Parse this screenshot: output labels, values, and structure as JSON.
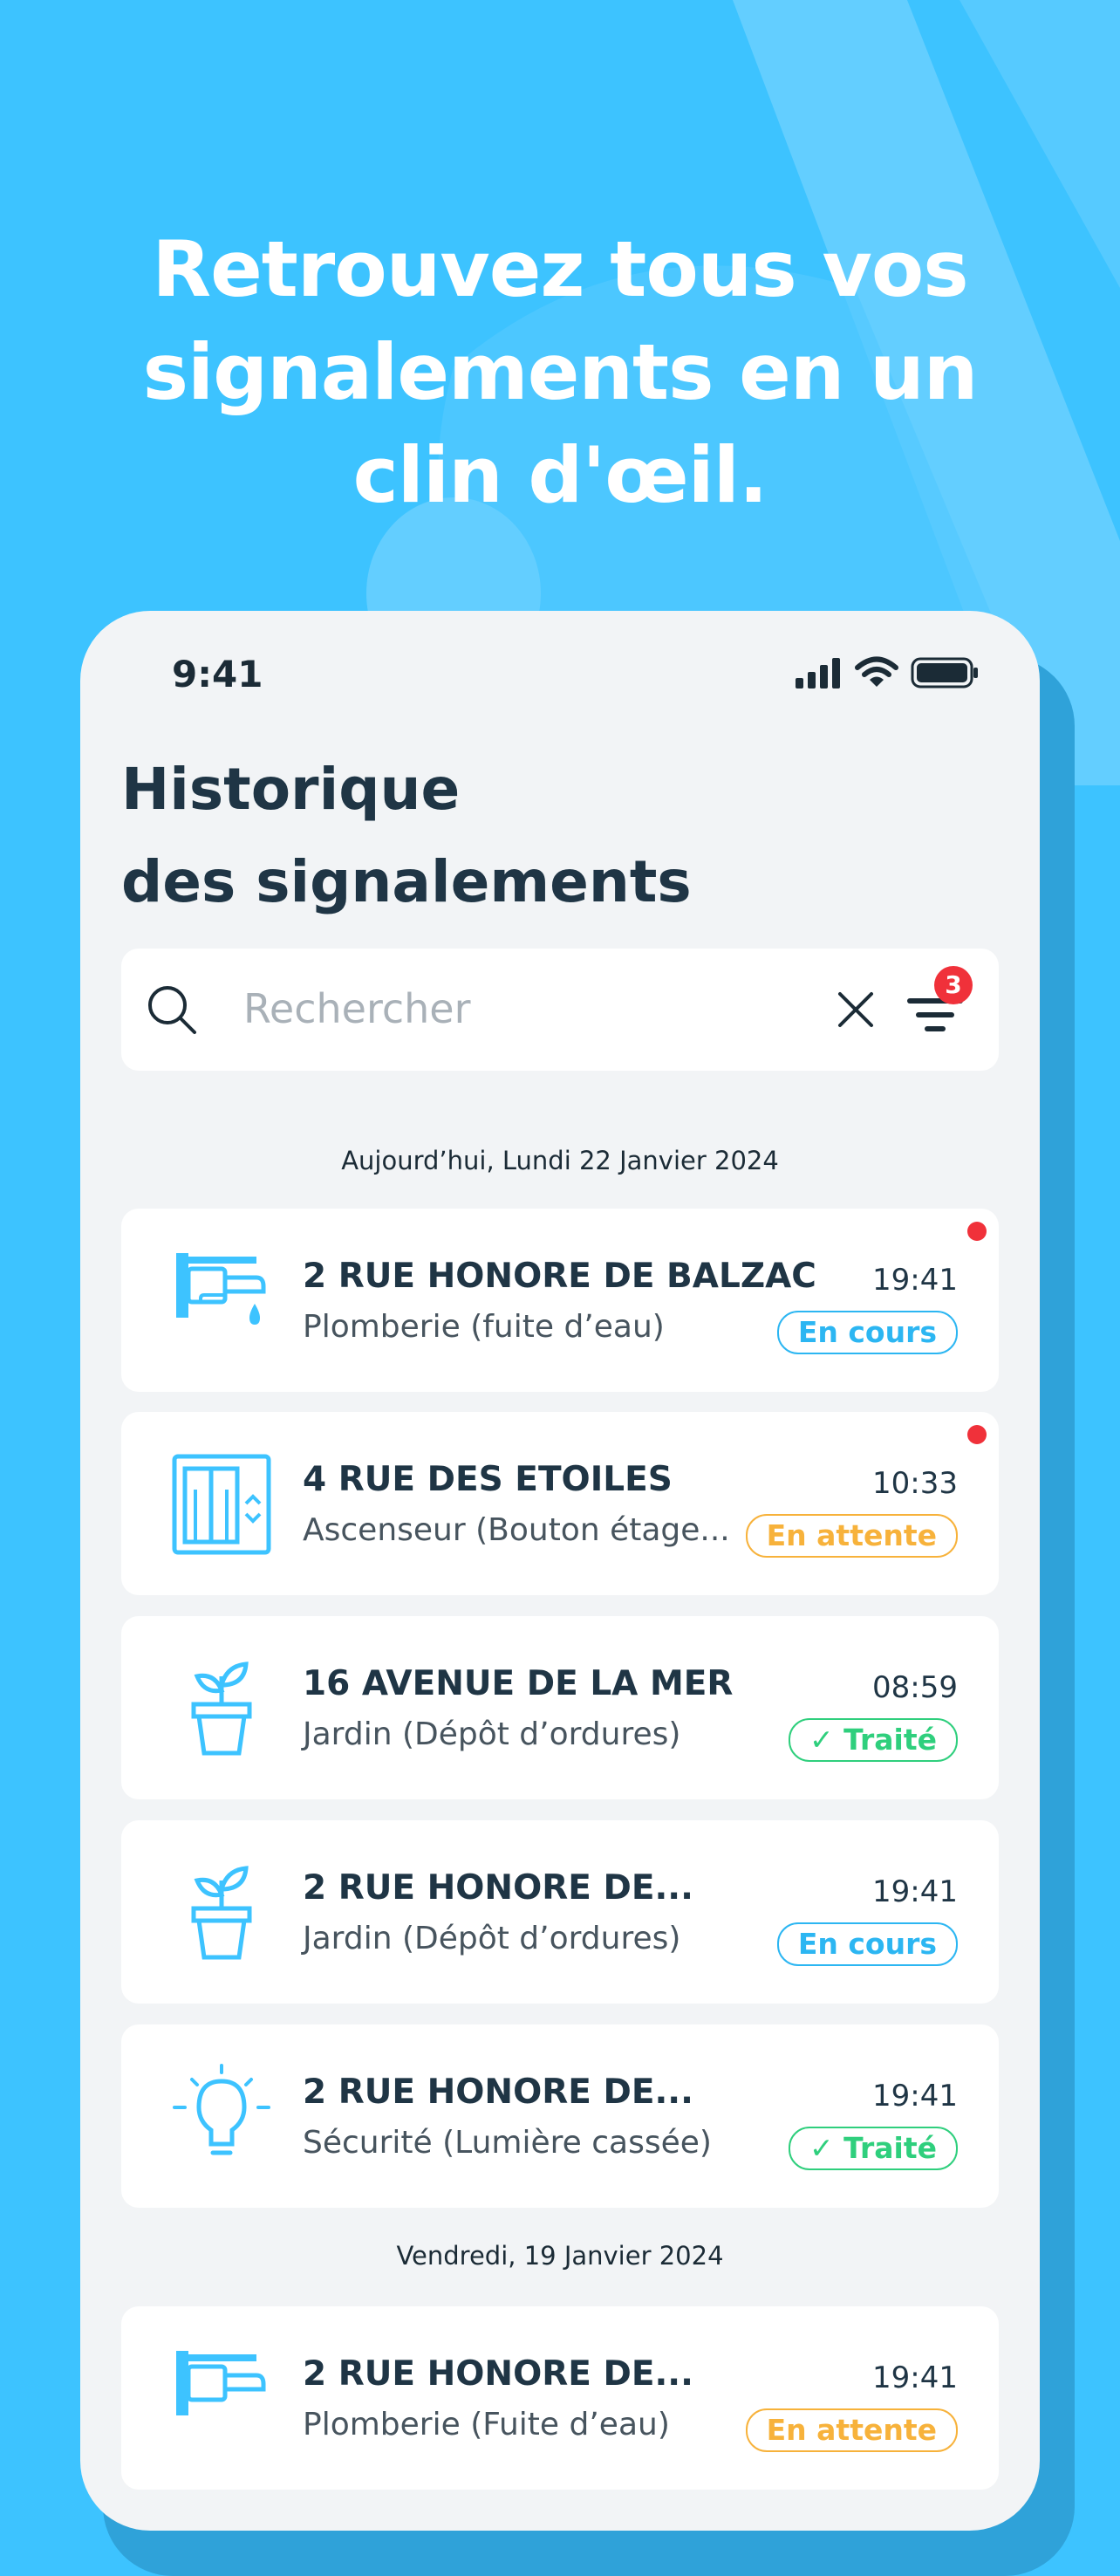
{
  "headline": {
    "line1": "Retrouvez tous vos",
    "line2": "signalements en un",
    "line3": "clin d'œil."
  },
  "status_bar": {
    "time": "9:41"
  },
  "page": {
    "title_line1": "Historique",
    "title_line2": "des signalements"
  },
  "search": {
    "placeholder": "Rechercher",
    "filter_count": "3"
  },
  "groups": [
    {
      "date_label": "Aujourd’hui, Lundi 22 Janvier 2024"
    },
    {
      "date_label": "Vendredi, 19 Janvier 2024"
    }
  ],
  "reports": [
    {
      "address": "2 RUE HONORE DE BALZAC",
      "category": "Plomberie (fuite d’eau)",
      "time": "19:41",
      "status": "En cours",
      "icon": "faucet-icon",
      "unread": true
    },
    {
      "address": "4 RUE DES ETOILES",
      "category": "Ascenseur (Bouton étage...",
      "time": "10:33",
      "status": "En attente",
      "icon": "elevator-icon",
      "unread": true
    },
    {
      "address": "16 AVENUE DE LA MER",
      "category": "Jardin (Dépôt d’ordures)",
      "time": "08:59",
      "status": "✓ Traité",
      "icon": "plant-icon",
      "unread": false
    },
    {
      "address": "2 RUE HONORE DE...",
      "category": "Jardin (Dépôt d’ordures)",
      "time": "19:41",
      "status": "En cours",
      "icon": "plant-icon",
      "unread": false
    },
    {
      "address": "2 RUE HONORE DE...",
      "category": "Sécurité (Lumière cassée)",
      "time": "19:41",
      "status": "✓ Traité",
      "icon": "lightbulb-icon",
      "unread": false
    },
    {
      "address": "2 RUE HONORE DE...",
      "category": "Plomberie (Fuite d’eau)",
      "time": "19:41",
      "status": "En attente",
      "icon": "faucet-icon",
      "unread": false
    }
  ],
  "colors": {
    "background": "#3DC3FF",
    "status_in_progress": "#2CB6F2",
    "status_pending": "#F7B23B",
    "status_done": "#2FCF7D",
    "unread_dot": "#F0313A",
    "title_text": "#1F3545"
  }
}
